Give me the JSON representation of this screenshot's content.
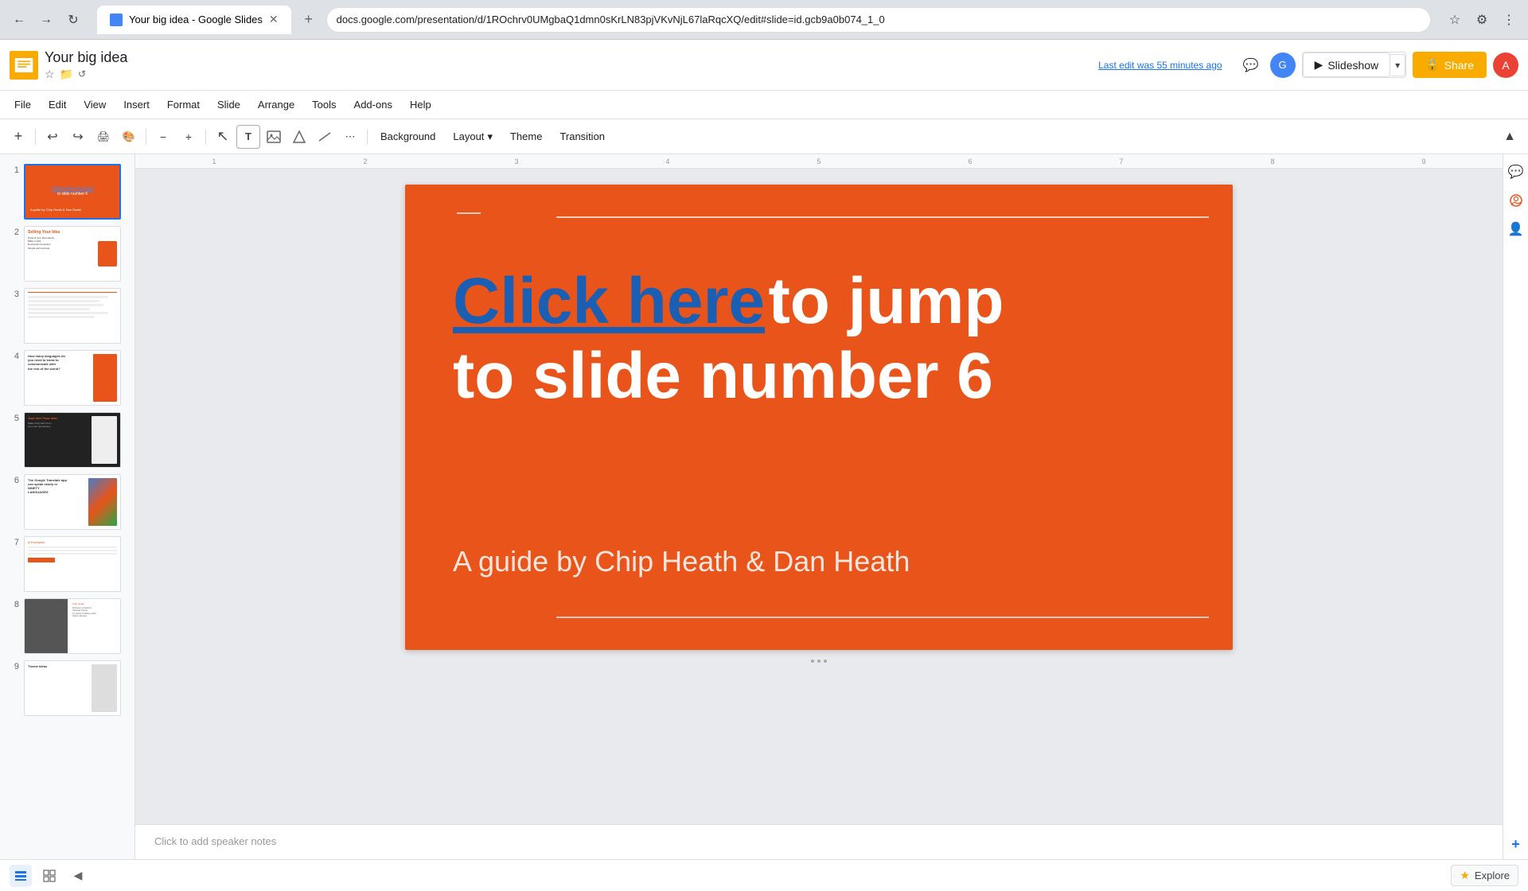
{
  "browser": {
    "tab_title": "Your big idea - Google Slides",
    "url": "docs.google.com/presentation/d/1ROchrv0UMgbaQ1dmn0sKrLN83pjVKvNjL67laRqcXQ/edit#slide=id.gcb9a0b074_1_0",
    "new_tab_icon": "+",
    "back_icon": "←",
    "forward_icon": "→",
    "reload_icon": "↻"
  },
  "header": {
    "app_title": "Your big idea",
    "star_icon": "☆",
    "folder_icon": "📁",
    "clock_icon": "🕐",
    "last_edit": "Last edit was 55 minutes ago",
    "comments_icon": "💬",
    "slideshow_label": "Slideshow",
    "slideshow_dropdown": "▾",
    "share_label": "Share",
    "lock_icon": "🔒",
    "user_initial": "A"
  },
  "menu": {
    "items": [
      "File",
      "Edit",
      "View",
      "Insert",
      "Format",
      "Slide",
      "Arrange",
      "Tools",
      "Add-ons",
      "Help"
    ]
  },
  "toolbar": {
    "add_icon": "+",
    "undo_icon": "↩",
    "redo_icon": "↪",
    "print_icon": "🖨",
    "paint_icon": "🎨",
    "zoom_in_icon": "+",
    "zoom_out_icon": "-",
    "select_icon": "↖",
    "text_box_icon": "T",
    "image_icon": "🖼",
    "shape_icon": "⬡",
    "line_icon": "/",
    "more_icon": "⋯",
    "background_label": "Background",
    "layout_label": "Layout",
    "layout_arrow": "▾",
    "theme_label": "Theme",
    "transition_label": "Transition",
    "collapse_icon": "▲"
  },
  "ruler": {
    "numbers": [
      "",
      "1",
      "2",
      "3",
      "4",
      "5",
      "6",
      "7",
      "8",
      "9"
    ]
  },
  "slides": [
    {
      "num": "1",
      "active": true
    },
    {
      "num": "2",
      "active": false
    },
    {
      "num": "3",
      "active": false
    },
    {
      "num": "4",
      "active": false
    },
    {
      "num": "5",
      "active": false
    },
    {
      "num": "6",
      "active": false
    },
    {
      "num": "7",
      "active": false
    },
    {
      "num": "8",
      "active": false
    },
    {
      "num": "9",
      "active": false
    }
  ],
  "slide": {
    "background_color": "#e8541a",
    "click_here_text": "Click here",
    "to_jump_text": " to jump",
    "line2_text": "to slide number 6",
    "author_text": "A guide by Chip Heath & Dan Heath",
    "top_line_color": "rgba(255,255,255,0.7)",
    "bottom_line_color": "rgba(255,255,255,0.7)"
  },
  "notes": {
    "placeholder": "Click to add speaker notes"
  },
  "right_sidebar": {
    "chat_icon": "💬",
    "image_icon": "🖼",
    "person_icon": "👤",
    "add_icon": "+"
  },
  "bottom_bar": {
    "list_view_icon": "≡",
    "grid_view_icon": "⊞",
    "collapse_icon": "◀",
    "explore_label": "Explore",
    "explore_star": "★"
  }
}
